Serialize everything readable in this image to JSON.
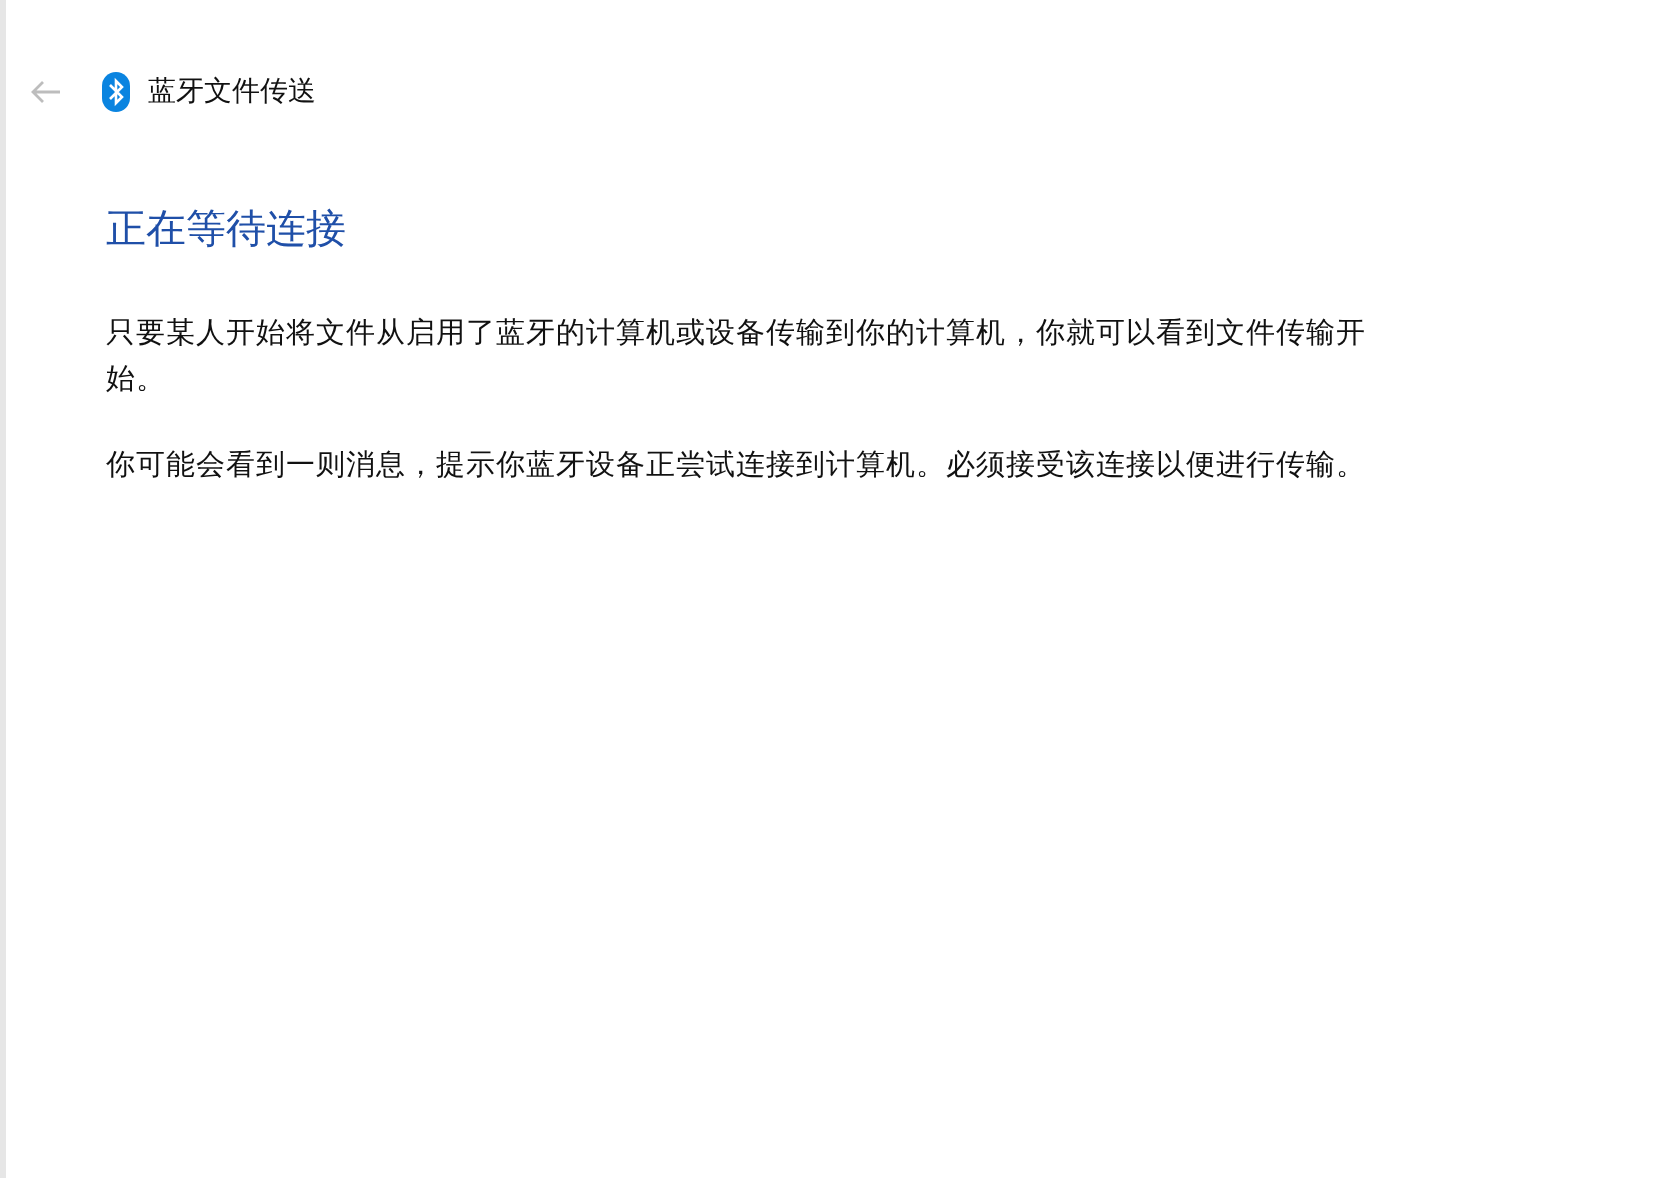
{
  "header": {
    "back_disabled": true,
    "title": "蓝牙文件传送"
  },
  "heading": "正在等待连接",
  "paragraphs": [
    "只要某人开始将文件从启用了蓝牙的计算机或设备传输到你的计算机，你就可以看到文件传输开始。",
    "你可能会看到一则消息，提示你蓝牙设备正尝试连接到计算机。必须接受该连接以便进行传输。"
  ]
}
